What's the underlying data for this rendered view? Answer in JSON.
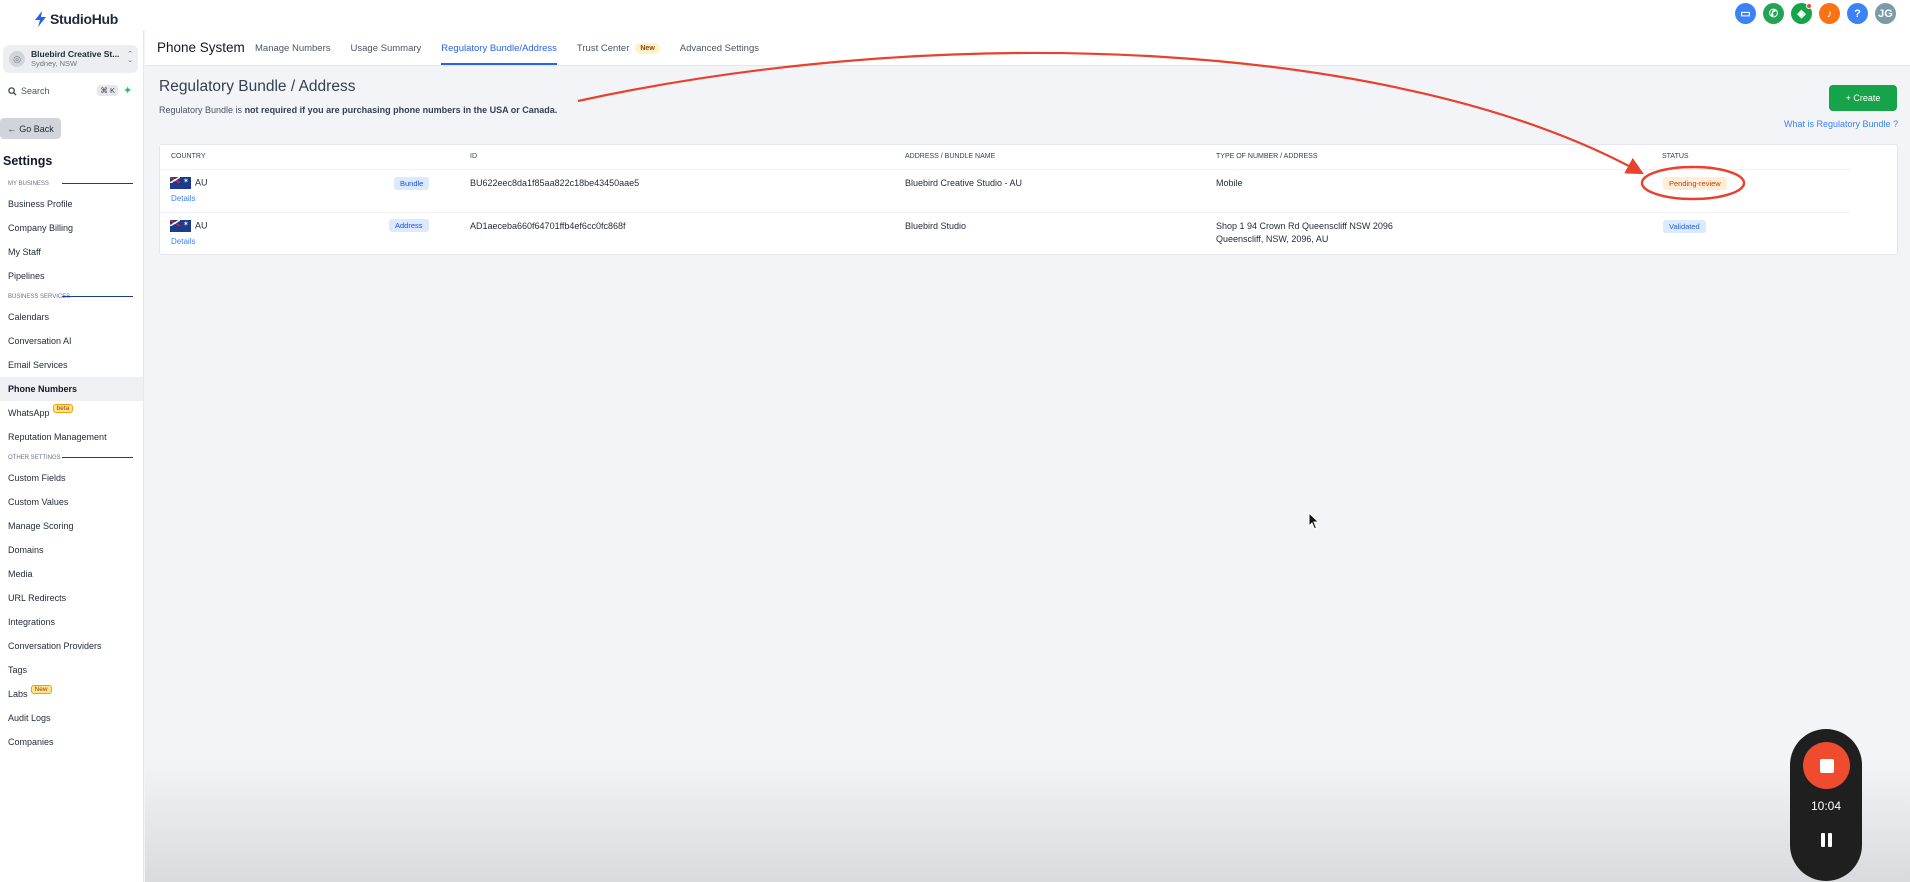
{
  "app": {
    "logo_text": "StudioHub",
    "brand_color": "#2563eb"
  },
  "top_icons": [
    {
      "name": "chat-icon",
      "color": "#3b82f6",
      "glyph": "▭"
    },
    {
      "name": "phone-icon",
      "color": "#22a455",
      "glyph": "✆"
    },
    {
      "name": "megaphone-icon",
      "color": "#16a34a",
      "glyph": "◈"
    },
    {
      "name": "bell-icon",
      "color": "#f97316",
      "glyph": "♪"
    },
    {
      "name": "help-icon",
      "color": "#3b82f6",
      "glyph": "?"
    },
    {
      "name": "user-avatar",
      "color": "#7c9aa8",
      "glyph": "JG"
    }
  ],
  "sidebar": {
    "account": {
      "name": "Bluebird Creative St...",
      "location": "Sydney, NSW"
    },
    "search": {
      "label": "Search",
      "shortcut": "⌘ K"
    },
    "go_back": "Go Back",
    "title": "Settings",
    "sections": [
      {
        "label": "MY BUSINESS",
        "items": [
          {
            "label": "Business Profile"
          },
          {
            "label": "Company Billing"
          },
          {
            "label": "My Staff"
          },
          {
            "label": "Pipelines"
          }
        ]
      },
      {
        "label": "BUSINESS SERVICES",
        "items": [
          {
            "label": "Calendars"
          },
          {
            "label": "Conversation AI"
          },
          {
            "label": "Email Services"
          },
          {
            "label": "Phone Numbers",
            "active": true
          },
          {
            "label": "WhatsApp",
            "badge": "beta"
          },
          {
            "label": "Reputation Management"
          }
        ]
      },
      {
        "label": "OTHER SETTINGS",
        "items": [
          {
            "label": "Custom Fields"
          },
          {
            "label": "Custom Values"
          },
          {
            "label": "Manage Scoring"
          },
          {
            "label": "Domains"
          },
          {
            "label": "Media"
          },
          {
            "label": "URL Redirects"
          },
          {
            "label": "Integrations"
          },
          {
            "label": "Conversation Providers"
          },
          {
            "label": "Tags"
          },
          {
            "label": "Labs",
            "badge": "New"
          },
          {
            "label": "Audit Logs"
          },
          {
            "label": "Companies"
          }
        ]
      }
    ]
  },
  "header": {
    "title": "Phone System",
    "tabs": [
      {
        "label": "Manage Numbers"
      },
      {
        "label": "Usage Summary"
      },
      {
        "label": "Regulatory Bundle/Address",
        "active": true
      },
      {
        "label": "Trust Center",
        "badge": "New"
      },
      {
        "label": "Advanced Settings"
      }
    ]
  },
  "page": {
    "title": "Regulatory Bundle / Address",
    "subtitle_prefix": "Regulatory Bundle is ",
    "subtitle_bold": "not required if you are purchasing phone numbers in the USA or Canada.",
    "create_button": "+ Create",
    "help_link": "What is Regulatory Bundle ?"
  },
  "table": {
    "columns": [
      "COUNTRY",
      "ID",
      "ADDRESS / BUNDLE NAME",
      "TYPE OF NUMBER / ADDRESS",
      "STATUS"
    ],
    "rows": [
      {
        "country": "AU",
        "type_badge": "Bundle",
        "details": "Details",
        "id": "BU622eec8da1f85aa822c18be43450aae5",
        "name": "Bluebird Creative Studio - AU",
        "type_line1": "Mobile",
        "type_line2": "",
        "status": "Pending-review"
      },
      {
        "country": "AU",
        "type_badge": "Address",
        "details": "Details",
        "id": "AD1aeceba660f64701ffb4ef6cc0fc868f",
        "name": "Bluebird Studio",
        "type_line1": "Shop 1 94 Crown Rd Queenscliff NSW 2096",
        "type_line2": "Queenscliff, NSW, 2096, AU",
        "status": "Validated"
      }
    ]
  },
  "recorder": {
    "time": "10:04"
  },
  "annotation": {
    "color": "#e8412c"
  }
}
